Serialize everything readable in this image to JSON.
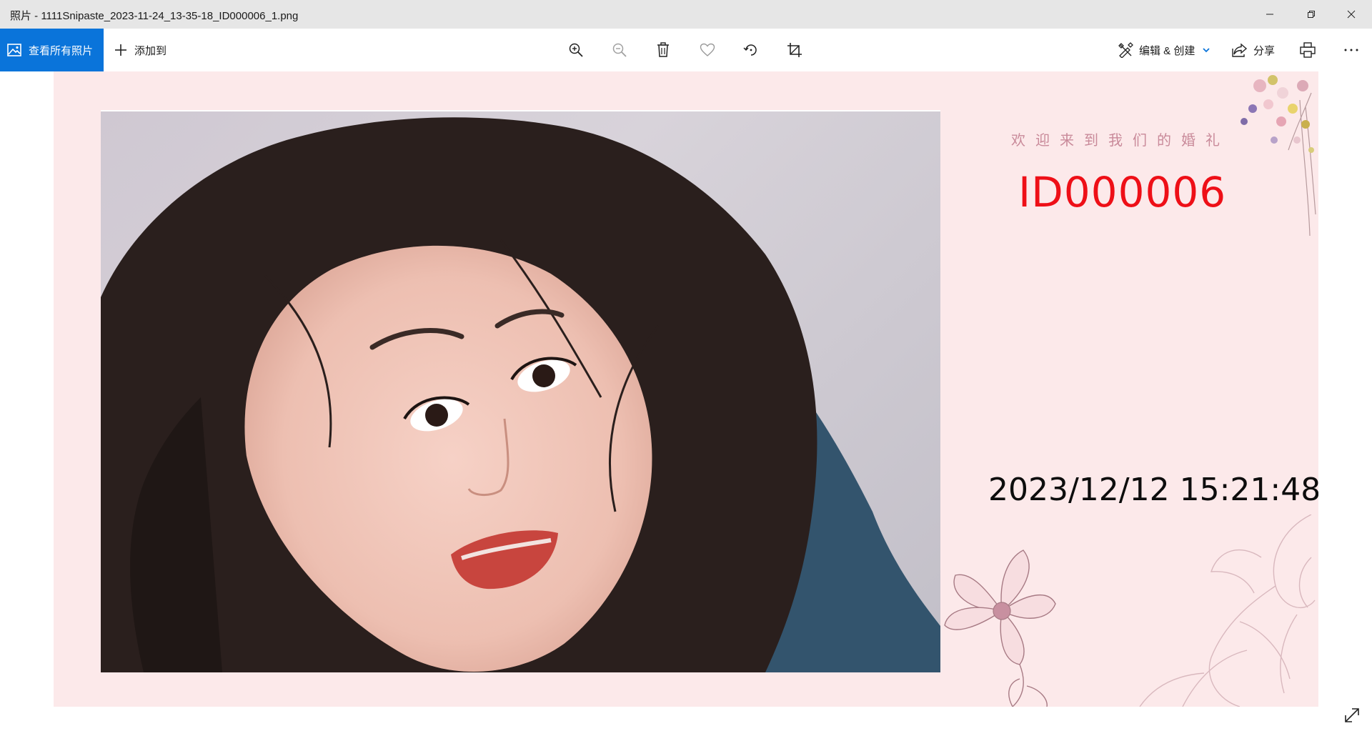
{
  "window": {
    "title": "照片 - 1111Snipaste_2023-11-24_13-35-18_ID000006_1.png"
  },
  "toolbar": {
    "all_photos_label": "查看所有照片",
    "add_to_label": "添加到",
    "edit_create_label": "编辑 & 创建",
    "share_label": "分享",
    "tools": [
      "zoom-in",
      "zoom-out",
      "delete",
      "favorite",
      "rotate",
      "crop"
    ],
    "accent": "#0a74da"
  },
  "image": {
    "welcome_text": "欢迎来到我们的婚礼",
    "id_text": "ID000006",
    "datetime_text": "2023/12/12 15:21:48",
    "id_color": "#ee0f17",
    "background": "#fce9ea"
  }
}
